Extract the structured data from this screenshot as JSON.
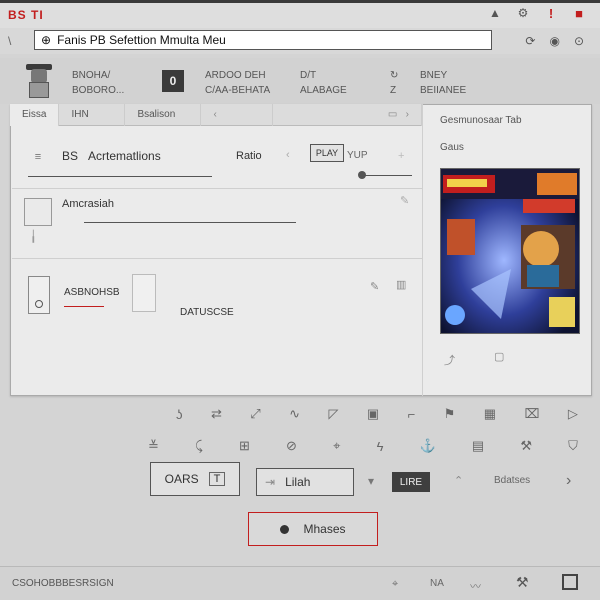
{
  "app": {
    "logo": "BS TI"
  },
  "topbar": {
    "icons": [
      "triangle-icon",
      "gear-icon",
      "alert-icon",
      "square-icon"
    ]
  },
  "address": {
    "value": "Fanis PB Sefettion Mmulta Meu",
    "prefix_icon": "glasses-icon"
  },
  "header": {
    "col1": [
      "BNOHA/",
      "BOBORO..."
    ],
    "col2": [
      "ARDOO DEH",
      "C/AA-BEHATA"
    ],
    "col3": [
      "D/T",
      "ALABAGE"
    ],
    "col4": [
      "BNEY",
      "BEIIANEE"
    ]
  },
  "tabs": [
    "Eissa",
    "IHN",
    "Bsalison"
  ],
  "right_panel": {
    "title": "Gesmunosaar Tab",
    "label": "Gaus"
  },
  "rows": [
    {
      "prefix": "BS",
      "label": "Acrtematlions",
      "right_label": "Ratio",
      "right_tag": "PLAY",
      "right_text": "YUP"
    },
    {
      "label": "Amcrasiah"
    },
    {
      "label": "ASBNOHSB",
      "sub_label": "DATUSCSE"
    }
  ],
  "buttons": {
    "card_button": "OARS",
    "card_icon": "T",
    "lite_text": "LIRE",
    "submit_text": "Lilah",
    "sources_label": "Bdatses",
    "main_button": "Mhases"
  },
  "status": {
    "text": "CSOHOBBBESRSIGN",
    "right_text": "NA"
  },
  "colors": {
    "accent": "#c21e1e",
    "background": "#d4d4d4",
    "panel": "#ebebeb"
  }
}
